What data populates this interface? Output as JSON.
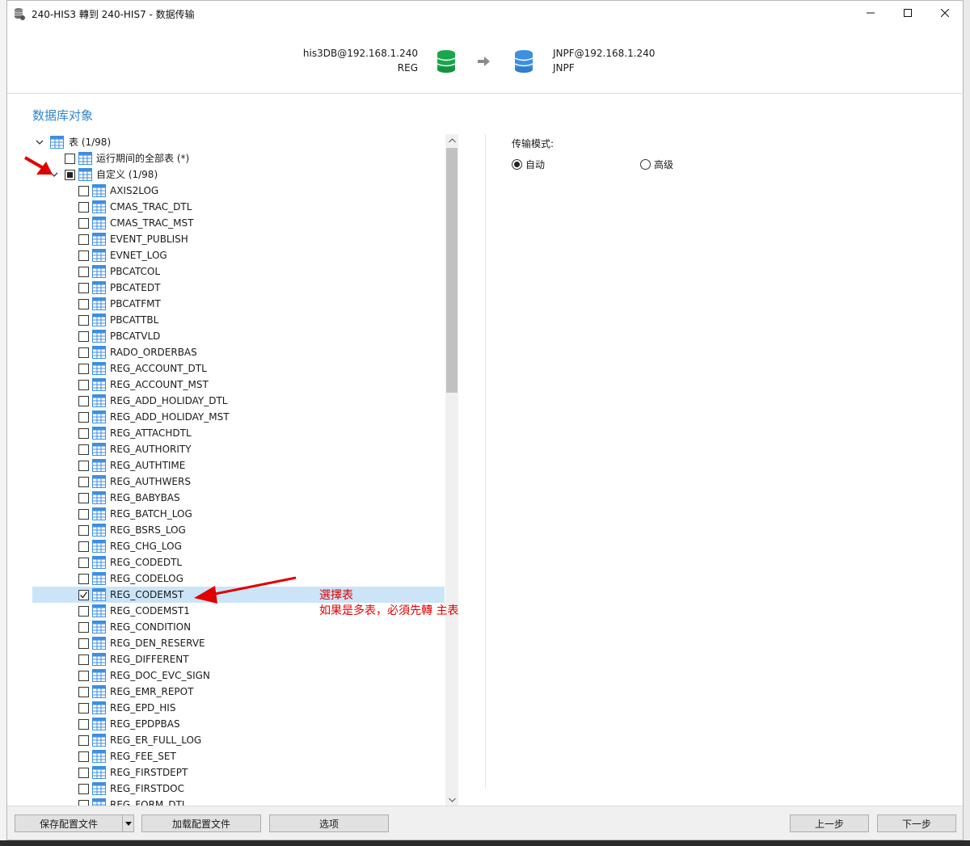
{
  "window": {
    "title": "240-HIS3 轉到 240-HIS7 - 数据传输"
  },
  "source": {
    "connection": "his3DB@192.168.1.240",
    "schema": "REG"
  },
  "target": {
    "connection": "JNPF@192.168.1.240",
    "schema": "JNPF"
  },
  "section_title": "数据库对象",
  "tree": {
    "root_label": "表 (1/98)",
    "all_tables_label": "运行期间的全部表 (*)",
    "custom_label": "自定义 (1/98)",
    "tables": [
      {
        "name": "AXIS2LOG",
        "checked": false
      },
      {
        "name": "CMAS_TRAC_DTL",
        "checked": false
      },
      {
        "name": "CMAS_TRAC_MST",
        "checked": false
      },
      {
        "name": "EVENT_PUBLISH",
        "checked": false
      },
      {
        "name": "EVNET_LOG",
        "checked": false
      },
      {
        "name": "PBCATCOL",
        "checked": false
      },
      {
        "name": "PBCATEDT",
        "checked": false
      },
      {
        "name": "PBCATFMT",
        "checked": false
      },
      {
        "name": "PBCATTBL",
        "checked": false
      },
      {
        "name": "PBCATVLD",
        "checked": false
      },
      {
        "name": "RADO_ORDERBAS",
        "checked": false
      },
      {
        "name": "REG_ACCOUNT_DTL",
        "checked": false
      },
      {
        "name": "REG_ACCOUNT_MST",
        "checked": false
      },
      {
        "name": "REG_ADD_HOLIDAY_DTL",
        "checked": false
      },
      {
        "name": "REG_ADD_HOLIDAY_MST",
        "checked": false
      },
      {
        "name": "REG_ATTACHDTL",
        "checked": false
      },
      {
        "name": "REG_AUTHORITY",
        "checked": false
      },
      {
        "name": "REG_AUTHTIME",
        "checked": false
      },
      {
        "name": "REG_AUTHWERS",
        "checked": false
      },
      {
        "name": "REG_BABYBAS",
        "checked": false
      },
      {
        "name": "REG_BATCH_LOG",
        "checked": false
      },
      {
        "name": "REG_BSRS_LOG",
        "checked": false
      },
      {
        "name": "REG_CHG_LOG",
        "checked": false
      },
      {
        "name": "REG_CODEDTL",
        "checked": false
      },
      {
        "name": "REG_CODELOG",
        "checked": false
      },
      {
        "name": "REG_CODEMST",
        "checked": true
      },
      {
        "name": "REG_CODEMST1",
        "checked": false
      },
      {
        "name": "REG_CONDITION",
        "checked": false
      },
      {
        "name": "REG_DEN_RESERVE",
        "checked": false
      },
      {
        "name": "REG_DIFFERENT",
        "checked": false
      },
      {
        "name": "REG_DOC_EVC_SIGN",
        "checked": false
      },
      {
        "name": "REG_EMR_REPOT",
        "checked": false
      },
      {
        "name": "REG_EPD_HIS",
        "checked": false
      },
      {
        "name": "REG_EPDPBAS",
        "checked": false
      },
      {
        "name": "REG_ER_FULL_LOG",
        "checked": false
      },
      {
        "name": "REG_FEE_SET",
        "checked": false
      },
      {
        "name": "REG_FIRSTDEPT",
        "checked": false
      },
      {
        "name": "REG_FIRSTDOC",
        "checked": false
      },
      {
        "name": "REG_FORM_DTL",
        "checked": false
      }
    ]
  },
  "transfer_mode": {
    "label": "传输模式:",
    "options": [
      {
        "label": "自动",
        "selected": true
      },
      {
        "label": "高级",
        "selected": false
      }
    ]
  },
  "annotation": {
    "line1": "選擇表",
    "line2": "如果是多表，必須先轉 主表",
    "color": "#e00000"
  },
  "footer": {
    "save_profile": "保存配置文件",
    "load_profile": "加载配置文件",
    "options": "选项",
    "prev": "上一步",
    "next": "下一步"
  },
  "icons": {
    "source_db": "database-green-icon",
    "target_db": "database-blue-icon",
    "table": "table-grid-icon"
  },
  "colors": {
    "accent": "#2f86c8",
    "selection": "#cce4f7",
    "source_db": "#1aa64a",
    "target_db": "#3d8fe0"
  }
}
